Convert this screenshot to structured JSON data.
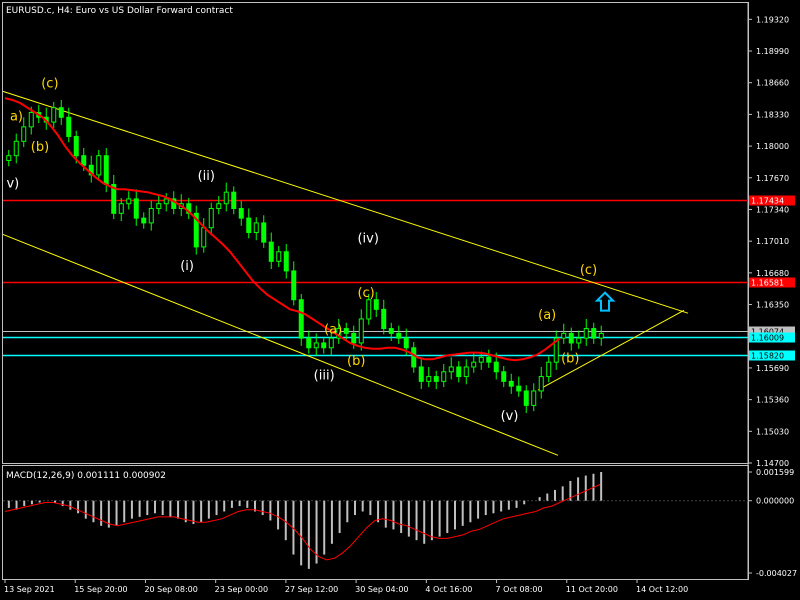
{
  "header": {
    "symbol_label": "EURUSD.c, H4:  Euro vs US Dollar Forward contract"
  },
  "colors": {
    "background": "#000000",
    "axis": "#c0c0c0",
    "grid_text": "#ffffff",
    "bull": "#00ff00",
    "bear": "#00ff00",
    "moving_average": "#ff0000",
    "channel": "#ffff00",
    "red_level": "#ff0000",
    "cyan_level": "#00ffff",
    "gray_level": "#c0c0c0",
    "wave_white": "#ffffff",
    "wave_yellow": "#ffd700",
    "macd_hist": "#c0c0c0",
    "macd_signal": "#ff0000"
  },
  "chart_data": [
    {
      "type": "candlestick",
      "title": "EURUSD.c, H4:  Euro vs US Dollar Forward contract",
      "y_ticks": [
        "1.19320",
        "1.18990",
        "1.18660",
        "1.18330",
        "1.18000",
        "1.17670",
        "1.17340",
        "1.17010",
        "1.16680",
        "1.16350",
        "1.16020",
        "1.15690",
        "1.15360",
        "1.15030",
        "1.14700"
      ],
      "x_ticks": [
        "13 Sep 2021",
        "15 Sep 20:00",
        "20 Sep 08:00",
        "23 Sep 00:00",
        "27 Sep 12:00",
        "30 Sep 04:00",
        "4 Oct 16:00",
        "7 Oct 08:00",
        "11 Oct 20:00",
        "14 Oct 12:00"
      ],
      "ylim": [
        1.147,
        1.1949
      ],
      "price_levels": [
        {
          "label": "1.17434",
          "value": 1.17434,
          "color": "#ff0000",
          "kind": "horizontal"
        },
        {
          "label": "1.16581",
          "value": 1.16581,
          "color": "#ff0000",
          "kind": "horizontal"
        },
        {
          "label": "1.16074",
          "value": 1.16074,
          "color": "#c0c0c0",
          "kind": "horizontal"
        },
        {
          "label": "1.16009",
          "value": 1.16009,
          "color": "#00ffff",
          "kind": "horizontal"
        },
        {
          "label": "1.15820",
          "value": 1.1582,
          "color": "#00ffff",
          "kind": "horizontal"
        }
      ],
      "close_path": [
        1.179,
        1.1805,
        1.182,
        1.1835,
        1.183,
        1.1825,
        1.184,
        1.183,
        1.181,
        1.179,
        1.178,
        1.177,
        1.179,
        1.176,
        1.173,
        1.174,
        1.1745,
        1.1725,
        1.172,
        1.1735,
        1.174,
        1.1745,
        1.1735,
        1.174,
        1.173,
        1.1695,
        1.1715,
        1.1735,
        1.174,
        1.1752,
        1.1735,
        1.1725,
        1.171,
        1.172,
        1.17,
        1.168,
        1.169,
        1.167,
        1.164,
        1.16,
        1.159,
        1.1595,
        1.159,
        1.16,
        1.161,
        1.1605,
        1.1595,
        1.162,
        1.164,
        1.163,
        1.161,
        1.1605,
        1.16,
        1.159,
        1.157,
        1.1555,
        1.156,
        1.1555,
        1.1565,
        1.157,
        1.156,
        1.157,
        1.1575,
        1.158,
        1.1575,
        1.1565,
        1.1555,
        1.155,
        1.1545,
        1.153,
        1.1545,
        1.156,
        1.1575,
        1.16,
        1.1605,
        1.1595,
        1.16,
        1.161,
        1.16,
        1.1605
      ],
      "ma_path": [
        1.185,
        1.1848,
        1.1845,
        1.184,
        1.1835,
        1.183,
        1.1822,
        1.1812,
        1.18,
        1.179,
        1.1782,
        1.1775,
        1.1768,
        1.1762,
        1.1758,
        1.1755,
        1.1755,
        1.1754,
        1.1753,
        1.1752,
        1.175,
        1.1748,
        1.1745,
        1.174,
        1.1735,
        1.1728,
        1.172,
        1.1712,
        1.1705,
        1.1698,
        1.169,
        1.168,
        1.167,
        1.166,
        1.1652,
        1.1645,
        1.164,
        1.1635,
        1.163,
        1.1628,
        1.1625,
        1.162,
        1.1615,
        1.161,
        1.1605,
        1.16,
        1.1595,
        1.1592,
        1.159,
        1.1589,
        1.1589,
        1.159,
        1.159,
        1.1588,
        1.1585,
        1.158,
        1.1578,
        1.1578,
        1.158,
        1.1582,
        1.1583,
        1.1584,
        1.1585,
        1.1585,
        1.1584,
        1.1582,
        1.158,
        1.1578,
        1.1577,
        1.1578,
        1.158,
        1.1583,
        1.1588,
        1.1594,
        1.16
      ],
      "channel_lines": [
        {
          "from": [
            0,
            1.1857
          ],
          "to": [
            1,
            1.1626
          ]
        },
        {
          "from": [
            0,
            1.1708
          ],
          "to": [
            1,
            1.1478
          ]
        },
        {
          "from": [
            0,
            1.1546
          ],
          "to": [
            1,
            1.1629
          ]
        }
      ],
      "wave_labels": [
        {
          "text": "(c)",
          "color": "#ffd700",
          "x": 0.055,
          "price": 1.1866
        },
        {
          "text": "a)",
          "color": "#ffd700",
          "x": 0.01,
          "price": 1.1832
        },
        {
          "text": "(b)",
          "color": "#ffd700",
          "x": 0.04,
          "price": 1.18
        },
        {
          "text": "v)",
          "color": "#ffffff",
          "x": 0.005,
          "price": 1.1762
        },
        {
          "text": "(ii)",
          "color": "#ffffff",
          "x": 0.28,
          "price": 1.177
        },
        {
          "text": "(i)",
          "color": "#ffffff",
          "x": 0.255,
          "price": 1.1676
        },
        {
          "text": "(iv)",
          "color": "#ffffff",
          "x": 0.51,
          "price": 1.1705
        },
        {
          "text": "(c)",
          "color": "#ffd700",
          "x": 0.51,
          "price": 1.1648
        },
        {
          "text": "(a)",
          "color": "#ffd700",
          "x": 0.462,
          "price": 1.161
        },
        {
          "text": "(b)",
          "color": "#ffd700",
          "x": 0.495,
          "price": 1.1577
        },
        {
          "text": "(iii)",
          "color": "#ffffff",
          "x": 0.447,
          "price": 1.1562
        },
        {
          "text": "(v)",
          "color": "#ffffff",
          "x": 0.716,
          "price": 1.152
        },
        {
          "text": "(a)",
          "color": "#ffd700",
          "x": 0.77,
          "price": 1.1625
        },
        {
          "text": "(b)",
          "color": "#ffd700",
          "x": 0.803,
          "price": 1.158
        },
        {
          "text": "(c)",
          "color": "#ffd700",
          "x": 0.83,
          "price": 1.1672
        }
      ]
    },
    {
      "type": "bar",
      "title": "MACD(12,26,9) 0.001111 0.000902",
      "indicator": "MACD(12,26,9)",
      "macd_value": "0.001111",
      "signal_value": "0.000902",
      "y_ticks": [
        "0.001599",
        "0.000000",
        "-0.004027"
      ],
      "ylim": [
        -0.004027,
        0.001599
      ],
      "hist_path": [
        -0.0004,
        -0.0005,
        -0.0003,
        -0.0002,
        -0.0001,
        0.0,
        -0.0001,
        -0.0003,
        -0.0005,
        -0.0007,
        -0.001,
        -0.0012,
        -0.0014,
        -0.0015,
        -0.0014,
        -0.0012,
        -0.001,
        -0.0009,
        -0.0008,
        -0.0007,
        -0.0008,
        -0.0009,
        -0.001,
        -0.0012,
        -0.0013,
        -0.0012,
        -0.001,
        -0.0008,
        -0.0006,
        -0.0004,
        -0.0003,
        -0.0004,
        -0.0006,
        -0.0008,
        -0.0011,
        -0.0016,
        -0.0022,
        -0.003,
        -0.0036,
        -0.0038,
        -0.0035,
        -0.003,
        -0.0024,
        -0.0018,
        -0.0012,
        -0.0008,
        -0.0006,
        -0.0008,
        -0.0012,
        -0.0015,
        -0.0016,
        -0.0018,
        -0.002,
        -0.0022,
        -0.0024,
        -0.0022,
        -0.002,
        -0.0018,
        -0.0016,
        -0.0014,
        -0.0012,
        -0.001,
        -0.0008,
        -0.0007,
        -0.0006,
        -0.0005,
        -0.0004,
        -0.0002,
        0.0,
        0.0002,
        0.0004,
        0.0006,
        0.0008,
        0.0011,
        0.0013,
        0.0014,
        0.0015,
        0.0016
      ],
      "signal_path": [
        -0.0006,
        -0.0005,
        -0.0004,
        -0.0003,
        -0.0002,
        -0.0001,
        -0.0001,
        -0.0002,
        -0.0003,
        -0.0005,
        -0.0007,
        -0.0009,
        -0.0011,
        -0.0013,
        -0.0014,
        -0.0013,
        -0.0012,
        -0.0011,
        -0.001,
        -0.0009,
        -0.0009,
        -0.0009,
        -0.001,
        -0.0011,
        -0.0012,
        -0.0012,
        -0.0011,
        -0.001,
        -0.0008,
        -0.0006,
        -0.0005,
        -0.0005,
        -0.0006,
        -0.0007,
        -0.0009,
        -0.0012,
        -0.0016,
        -0.0021,
        -0.0027,
        -0.0031,
        -0.0033,
        -0.0032,
        -0.0029,
        -0.0025,
        -0.002,
        -0.0015,
        -0.0011,
        -0.001,
        -0.0011,
        -0.0013,
        -0.0014,
        -0.0016,
        -0.0018,
        -0.002,
        -0.0021,
        -0.0021,
        -0.002,
        -0.0019,
        -0.0017,
        -0.0016,
        -0.0014,
        -0.0012,
        -0.001,
        -0.0009,
        -0.0008,
        -0.0007,
        -0.0006,
        -0.0004,
        -0.0003,
        -0.0001,
        0.0001,
        0.0003,
        0.0005,
        0.0007,
        0.0009
      ]
    }
  ],
  "arrow_marker": {
    "name": "up-arrow-icon",
    "color": "#00bfff",
    "price": 1.1637
  }
}
